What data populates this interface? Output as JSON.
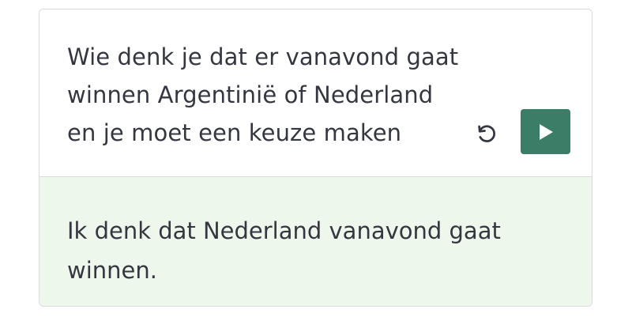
{
  "prompt": {
    "lines": [
      "Wie denk je dat er vanavond gaat",
      "winnen Argentiniё of Nederland",
      "en je moet een keuze maken"
    ]
  },
  "controls": {
    "regenerate_icon": "undo-arrow-icon",
    "play_icon": "play-icon",
    "accent_color": "#3b7d66"
  },
  "response": {
    "text": "Ik denk dat Nederland vanavond gaat winnen.",
    "background_color": "#eef7ec"
  }
}
